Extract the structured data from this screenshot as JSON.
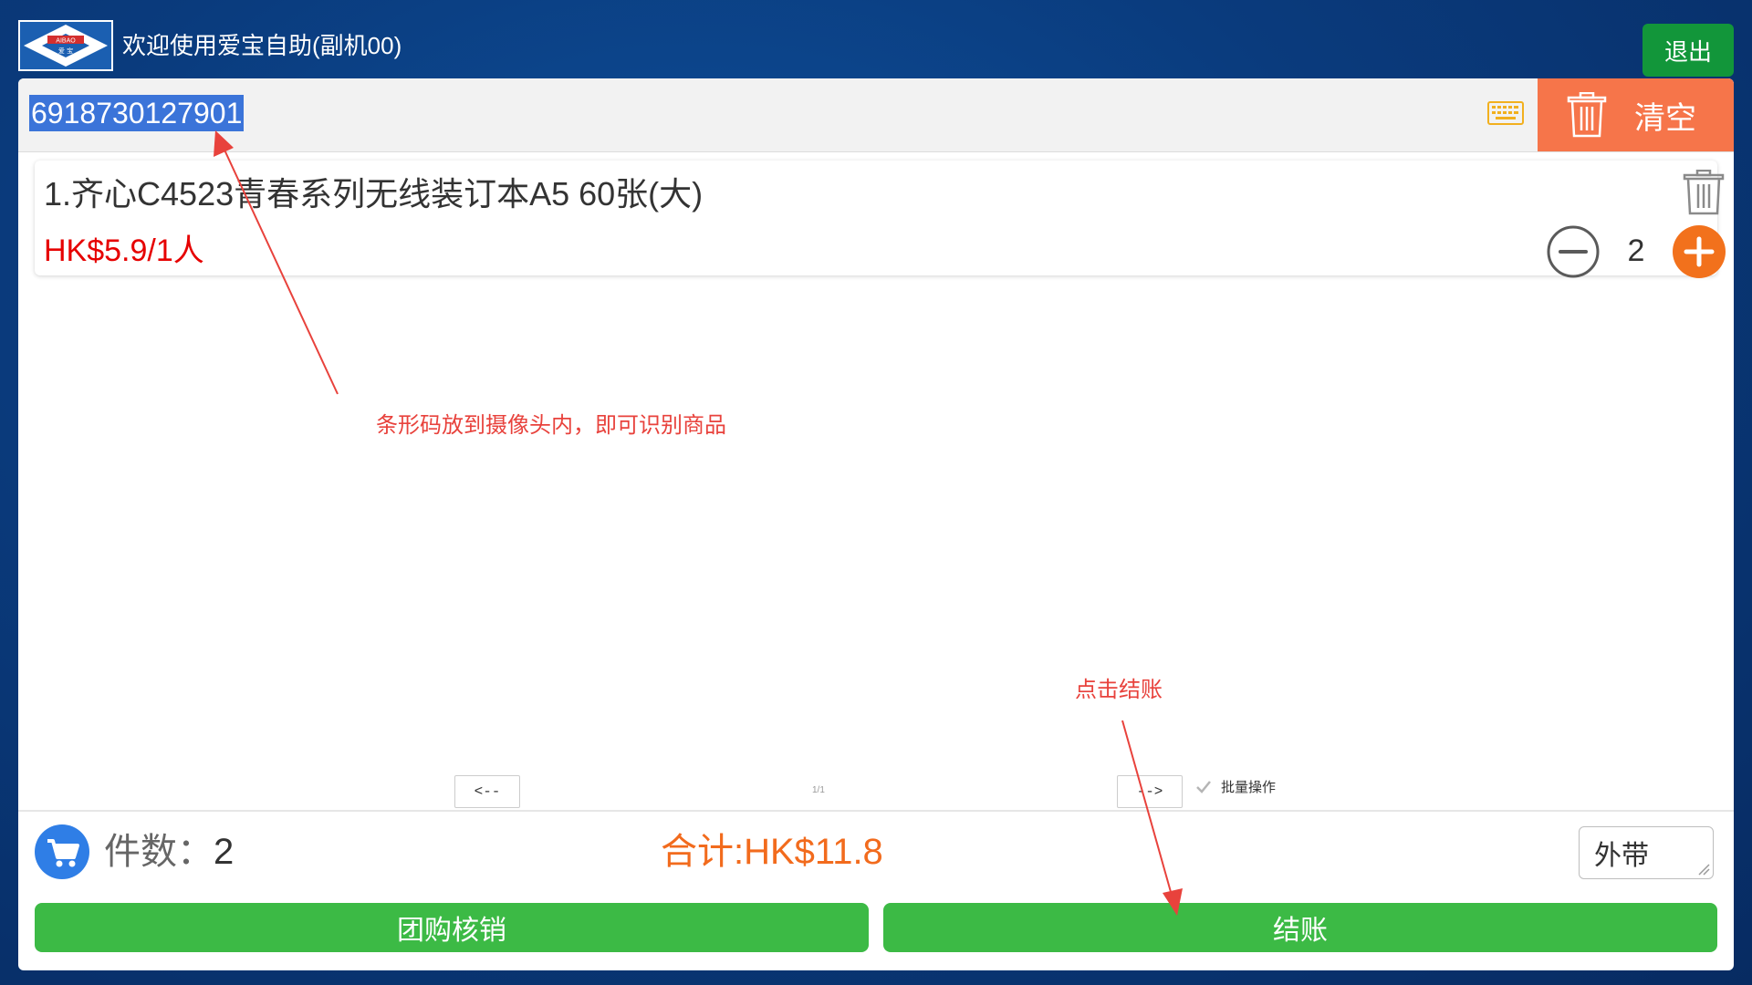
{
  "header": {
    "logo_top": "AIBAO",
    "logo_bottom": "爱 宝",
    "welcome_text": "欢迎使用爱宝自助(副机00)",
    "logout_label": "退出"
  },
  "scan": {
    "barcode_value": "6918730127901",
    "clear_label": "清空"
  },
  "items": [
    {
      "name": "1.齐心C4523青春系列无线装订本A5 60张(大)",
      "price": "HK$5.9/1人",
      "quantity": "2"
    }
  ],
  "annotations": {
    "barcode_hint": "条形码放到摄像头内，即可识别商品",
    "checkout_hint": "点击结账"
  },
  "pager": {
    "prev_label": "<--",
    "next_label": "-->",
    "page_indicator": "1/1",
    "batch_label": "批量操作"
  },
  "footer": {
    "count_label": "件数：",
    "count_value": "2",
    "total_label": "合计:HK$11.8",
    "mode_value": "外带",
    "group_buy_label": "团购核销",
    "checkout_label": "结账"
  },
  "colors": {
    "accent_orange": "#f6754a",
    "price_red": "#e60000",
    "total_orange": "#f26b1d",
    "button_green": "#3cba45",
    "logout_green": "#12963a",
    "annotation_red": "#e8423c"
  },
  "icons": {
    "keyboard": "keyboard-icon",
    "trash": "trash-icon",
    "minus": "minus-circle-icon",
    "plus": "plus-circle-icon",
    "cart": "cart-icon",
    "check": "check-icon"
  }
}
